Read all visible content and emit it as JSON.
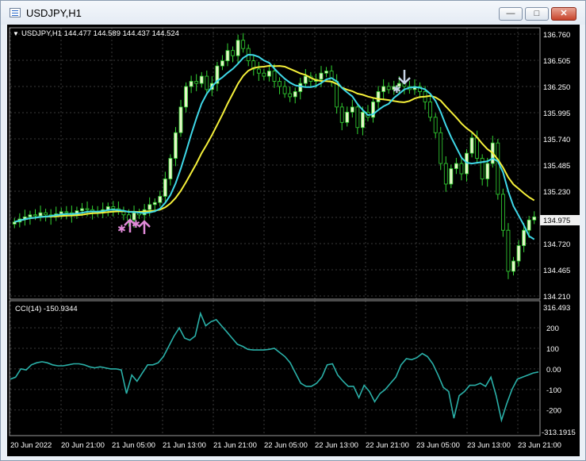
{
  "window": {
    "title": "USDJPY,H1",
    "minimize_glyph": "—",
    "maximize_glyph": "□",
    "close_glyph": "✕"
  },
  "chart": {
    "header": "USDJPY,H1  144.477 144.589 144.437 144.524",
    "colors": {
      "background": "#000000",
      "grid": "#3a3a3a",
      "bull_candle": "#e6f5c8",
      "candle_wick": "#33d633",
      "ma_fast": "#3fd8e8",
      "ma_slow": "#f5f03a",
      "signal_buy": "#e08ad8",
      "signal_sell": "#c8d4e8",
      "cci_line": "#2ab0a8",
      "text": "#ffffff"
    },
    "price_axis": [
      "136.760",
      "136.505",
      "136.250",
      "135.995",
      "135.740",
      "135.485",
      "135.230",
      "134.975",
      "134.720",
      "134.465",
      "134.210"
    ],
    "current_price": "134.975",
    "time_axis": [
      "20 Jun 2022",
      "20 Jun 21:00",
      "21 Jun 05:00",
      "21 Jun 13:00",
      "21 Jun 21:00",
      "22 Jun 05:00",
      "22 Jun 13:00",
      "22 Jun 21:00",
      "23 Jun 05:00",
      "23 Jun 13:00",
      "23 Jun 21:00"
    ],
    "cci_panel": {
      "label": "CCI(14) -150.9344",
      "top_value": "316.493",
      "bottom_value": "-313.1915",
      "levels": [
        "200",
        "100",
        "0.00",
        "-100",
        "-200"
      ]
    },
    "signals": {
      "buy_icon": "up-arrow-icon",
      "sell_icon": "down-arrow-icon"
    }
  },
  "chart_data": {
    "type": "candlestick",
    "symbol": "USDJPY",
    "timeframe": "H1",
    "ylim": [
      134.21,
      136.76
    ],
    "indicators": [
      {
        "name": "CCI(14)",
        "ylim": [
          -313.1915,
          316.493
        ],
        "values": [
          -50,
          -40,
          0,
          -5,
          20,
          30,
          35,
          30,
          20,
          15,
          15,
          20,
          25,
          25,
          20,
          10,
          5,
          10,
          5,
          0,
          0,
          -5,
          -120,
          -30,
          -60,
          -20,
          20,
          20,
          30,
          60,
          110,
          160,
          200,
          150,
          140,
          160,
          270,
          210,
          230,
          240,
          210,
          180,
          150,
          120,
          110,
          95,
          92,
          92,
          92,
          95,
          100,
          80,
          60,
          30,
          -20,
          -70,
          -85,
          -85,
          -70,
          -40,
          20,
          25,
          -30,
          -60,
          -85,
          -85,
          -140,
          -80,
          -110,
          -160,
          -120,
          -100,
          -70,
          -40,
          20,
          50,
          45,
          55,
          75,
          60,
          25,
          -30,
          -90,
          -110,
          -240,
          -130,
          -110,
          -80,
          -80,
          -70,
          -85,
          -40,
          -130,
          -250,
          -170,
          -100,
          -50,
          -40,
          -30,
          -20,
          -15
        ]
      }
    ]
  }
}
